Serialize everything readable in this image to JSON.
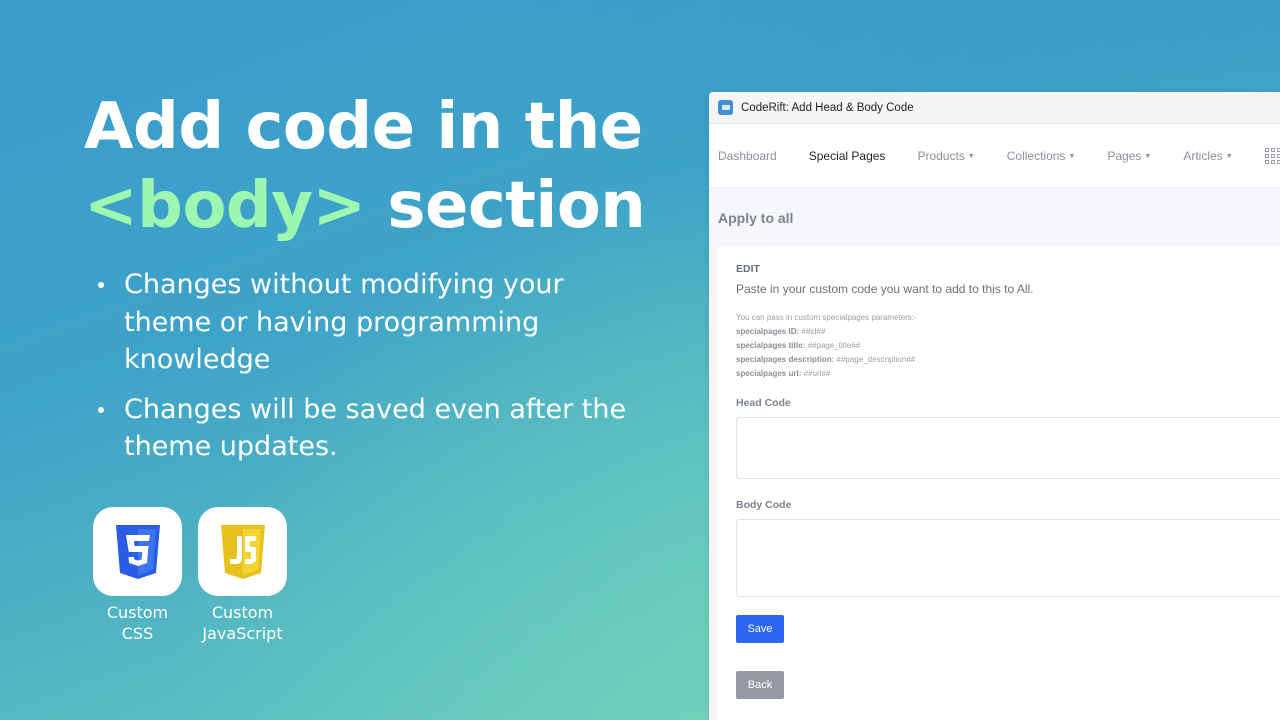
{
  "promo": {
    "title_line1": "Add code in the",
    "title_accent": "<body>",
    "title_line2_rest": " section",
    "accent_color": "#9ef7b0",
    "bullets": [
      "Changes without modifying your theme or having programming knowledge",
      "Changes will be saved even after the theme updates."
    ],
    "tiles": [
      {
        "icon": "css3-icon",
        "label_line1": "Custom",
        "label_line2": "CSS",
        "color": "#2b5ce6"
      },
      {
        "icon": "javascript-icon",
        "label_line1": "Custom",
        "label_line2": "JavaScript",
        "color": "#f0d224"
      }
    ]
  },
  "app": {
    "window_title": "CodeRift: Add Head & Body Code",
    "nav": {
      "items": [
        {
          "label": "Dashboard",
          "dropdown": false,
          "active": false
        },
        {
          "label": "Special Pages",
          "dropdown": false,
          "active": true
        },
        {
          "label": "Products",
          "dropdown": true,
          "active": false
        },
        {
          "label": "Collections",
          "dropdown": true,
          "active": false
        },
        {
          "label": "Pages",
          "dropdown": true,
          "active": false
        },
        {
          "label": "Articles",
          "dropdown": true,
          "active": false
        }
      ],
      "more_icon": "grid-icon"
    },
    "page_title": "Apply to all",
    "card": {
      "edit_label": "EDIT",
      "description": "Paste in your custom code you want to add to this to All.",
      "params_intro": "You can pass in custom specialpages parameters:-",
      "params": [
        {
          "name": "specialpages ID:",
          "value": "##id##"
        },
        {
          "name": "specialpages title:",
          "value": "##page_title##"
        },
        {
          "name": "specialpages description:",
          "value": "##page_description##"
        },
        {
          "name": "specialpages url:",
          "value": "##url##"
        }
      ],
      "head_code": {
        "label": "Head Code",
        "value": ""
      },
      "body_code": {
        "label": "Body Code",
        "value": ""
      },
      "save_label": "Save",
      "back_label": "Back",
      "save_color": "#2b66f0",
      "back_color": "#959aa3"
    }
  }
}
